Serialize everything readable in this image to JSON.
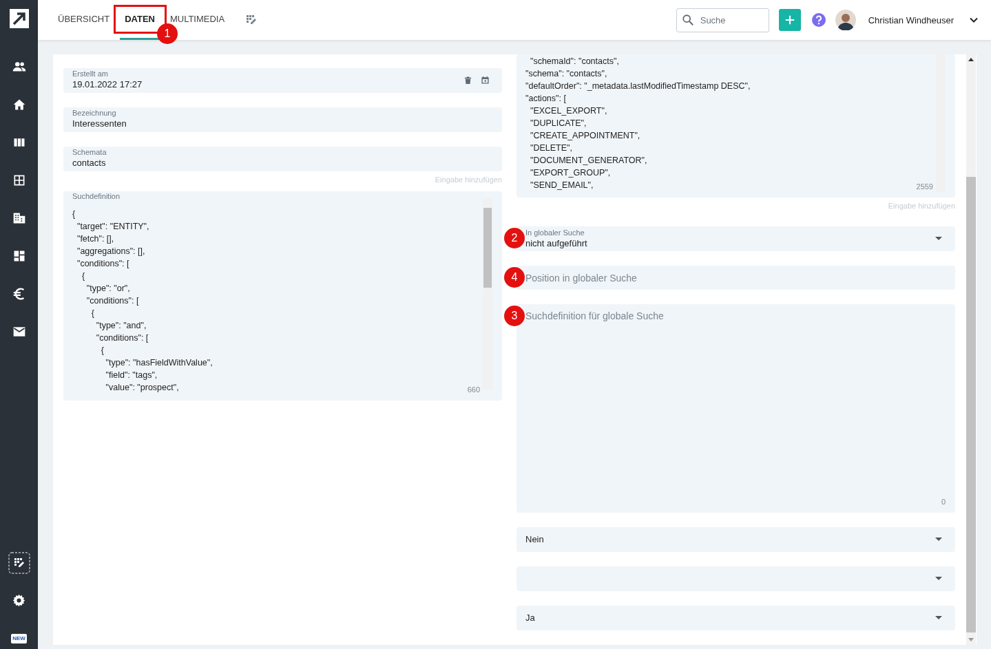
{
  "sidebar": {
    "new_badge": "NEW"
  },
  "tabs": [
    {
      "label": "ÜBERSICHT",
      "selected": false
    },
    {
      "label": "DATEN",
      "selected": true,
      "callout": "1"
    },
    {
      "label": "MULTIMEDIA",
      "selected": false
    }
  ],
  "search": {
    "placeholder": "Suche"
  },
  "user": {
    "name": "Christian Windheuser"
  },
  "left_column": [
    {
      "kind": "date",
      "label": "Erstellt am",
      "value": "19.01.2022 17:27"
    },
    {
      "kind": "text",
      "label": "Bezeichnung",
      "value": "Interessenten"
    },
    {
      "kind": "text",
      "label": "Schemata",
      "value": "contacts",
      "hint": "Eingabe hinzufügen"
    },
    {
      "kind": "code",
      "label": "Suchdefinition",
      "counter": "660",
      "lines": [
        "{",
        "  \"target\": \"ENTITY\",",
        "  \"fetch\": [],",
        "  \"aggregations\": [],",
        "  \"conditions\": [",
        "    {",
        "      \"type\": \"or\",",
        "      \"conditions\": [",
        "        {",
        "          \"type\": \"and\",",
        "          \"conditions\": [",
        "            {",
        "              \"type\": \"hasFieldWithValue\",",
        "              \"field\": \"tags\",",
        "              \"value\": \"prospect\","
      ]
    }
  ],
  "right_column": [
    {
      "kind": "code",
      "counter": "2559",
      "hint": "Eingabe hinzufügen",
      "lines": [
        "  \"schemaId\": \"contacts\",",
        "\"schema\": \"contacts\",",
        "\"defaultOrder\": \"_metadata.lastModifiedTimestamp DESC\",",
        "\"actions\": [",
        "  \"EXCEL_EXPORT\",",
        "  \"DUPLICATE\",",
        "  \"CREATE_APPOINTMENT\",",
        "  \"DELETE\",",
        "  \"DOCUMENT_GENERATOR\",",
        "  \"EXPORT_GROUP\",",
        "  \"SEND_EMAIL\","
      ]
    },
    {
      "kind": "select",
      "label": "In globaler Suche",
      "value": "nicht aufgeführt",
      "callout": "2"
    },
    {
      "kind": "text",
      "placeholder": "Position in globaler Suche",
      "callout": "4"
    },
    {
      "kind": "textarea",
      "placeholder": "Suchdefinition für globale Suche",
      "counter": "0",
      "callout": "3"
    },
    {
      "kind": "select",
      "value": "Nein"
    },
    {
      "kind": "select"
    },
    {
      "kind": "select",
      "value": "Ja"
    }
  ]
}
